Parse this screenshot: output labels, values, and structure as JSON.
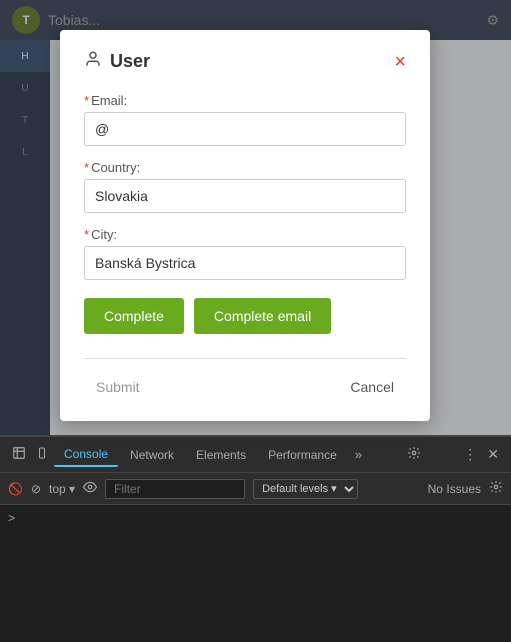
{
  "app": {
    "logo_text": "T",
    "title": "Tobias...",
    "gear_icon": "⚙",
    "sidebar_items": [
      "H",
      "U",
      "T",
      "L"
    ]
  },
  "modal": {
    "title": "User",
    "close_label": "×",
    "user_icon": "👤",
    "fields": {
      "email": {
        "label": "Email:",
        "required": true,
        "placeholder": "",
        "value": "@"
      },
      "country": {
        "label": "Country:",
        "required": true,
        "placeholder": "",
        "value": "Slovakia"
      },
      "city": {
        "label": "City:",
        "required": true,
        "placeholder": "",
        "value": "Banská Bystrica"
      }
    },
    "buttons": {
      "complete_label": "Complete",
      "complete_email_label": "Complete email",
      "submit_label": "Submit",
      "cancel_label": "Cancel"
    }
  },
  "devtools": {
    "tabs": [
      {
        "label": "Console",
        "active": true
      },
      {
        "label": "Network",
        "active": false
      },
      {
        "label": "Elements",
        "active": false
      },
      {
        "label": "Performance",
        "active": false
      }
    ],
    "more_tabs_label": "»",
    "subbar": {
      "filter_placeholder": "Filter",
      "level_label": "Default levels ▾",
      "issues_label": "No Issues"
    },
    "prompt": ">"
  }
}
